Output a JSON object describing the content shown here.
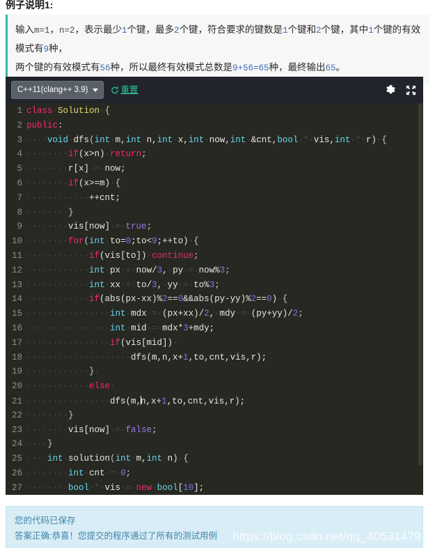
{
  "section": {
    "title": "例子说明1:",
    "explanation_line1_parts": [
      {
        "t": "输入",
        "k": "cn"
      },
      {
        "t": "m=1",
        "k": "mono"
      },
      {
        "t": "，",
        "k": "cn"
      },
      {
        "t": "n=2",
        "k": "mono"
      },
      {
        "t": "，表示最少",
        "k": "cn"
      },
      {
        "t": "1",
        "k": "num"
      },
      {
        "t": "个键，最多",
        "k": "cn"
      },
      {
        "t": "2",
        "k": "num"
      },
      {
        "t": "个键，符合要求的键数是",
        "k": "cn"
      },
      {
        "t": "1",
        "k": "num"
      },
      {
        "t": "个键和",
        "k": "cn"
      },
      {
        "t": "2",
        "k": "num"
      },
      {
        "t": "个键，其中",
        "k": "cn"
      },
      {
        "t": "1",
        "k": "num"
      },
      {
        "t": "个键的有效模式有",
        "k": "cn"
      },
      {
        "t": "9",
        "k": "num"
      },
      {
        "t": "种，",
        "k": "cn"
      }
    ],
    "explanation_line2_parts": [
      {
        "t": "两个键的有效模式有",
        "k": "cn"
      },
      {
        "t": "56",
        "k": "num"
      },
      {
        "t": "种，所以最终有效模式总数是",
        "k": "cn"
      },
      {
        "t": "9+56=65",
        "k": "num"
      },
      {
        "t": "种，最终输出",
        "k": "cn"
      },
      {
        "t": "65",
        "k": "num"
      },
      {
        "t": "。",
        "k": "cn"
      }
    ]
  },
  "editor": {
    "language_label": "C++11(clang++ 3.9)",
    "reset_label": "重置",
    "settings_icon": "gear-icon",
    "fullscreen_icon": "expand-icon",
    "dropdown_icon": "chevron-down-icon",
    "refresh_icon": "refresh-icon",
    "lines": [
      {
        "n": "1",
        "tokens": [
          {
            "t": "class",
            "k": "kw"
          },
          {
            "t": "·",
            "k": "ws"
          },
          {
            "t": "Solution",
            "k": "fn"
          },
          {
            "t": "·",
            "k": "ws"
          },
          {
            "t": "{",
            "k": "pun"
          }
        ]
      },
      {
        "n": "2",
        "tokens": [
          {
            "t": "public",
            "k": "kw"
          },
          {
            "t": ":",
            "k": "pun"
          }
        ]
      },
      {
        "n": "3",
        "tokens": [
          {
            "t": "····",
            "k": "ws"
          },
          {
            "t": "void",
            "k": "typ"
          },
          {
            "t": "·",
            "k": "ws"
          },
          {
            "t": "dfs",
            "k": "txt"
          },
          {
            "t": "(",
            "k": "pun"
          },
          {
            "t": "int",
            "k": "typ"
          },
          {
            "t": "·",
            "k": "ws"
          },
          {
            "t": "m,",
            "k": "txt"
          },
          {
            "t": "int",
            "k": "typ"
          },
          {
            "t": "·",
            "k": "ws"
          },
          {
            "t": "n,",
            "k": "txt"
          },
          {
            "t": "int",
            "k": "typ"
          },
          {
            "t": "·",
            "k": "ws"
          },
          {
            "t": "x,",
            "k": "txt"
          },
          {
            "t": "int",
            "k": "typ"
          },
          {
            "t": "·",
            "k": "ws"
          },
          {
            "t": "now,",
            "k": "txt"
          },
          {
            "t": "int",
            "k": "typ"
          },
          {
            "t": "·",
            "k": "ws"
          },
          {
            "t": "&cnt,",
            "k": "txt"
          },
          {
            "t": "bool",
            "k": "typ"
          },
          {
            "t": "·*·",
            "k": "ws"
          },
          {
            "t": "vis,",
            "k": "txt"
          },
          {
            "t": "int",
            "k": "typ"
          },
          {
            "t": "·*·",
            "k": "ws"
          },
          {
            "t": "r)",
            "k": "txt"
          },
          {
            "t": "·",
            "k": "ws"
          },
          {
            "t": "{",
            "k": "pun"
          }
        ]
      },
      {
        "n": "4",
        "tokens": [
          {
            "t": "········",
            "k": "ws"
          },
          {
            "t": "if",
            "k": "kw"
          },
          {
            "t": "(x>n)",
            "k": "txt"
          },
          {
            "t": "·",
            "k": "ws"
          },
          {
            "t": "return",
            "k": "kw"
          },
          {
            "t": ";",
            "k": "pun"
          }
        ]
      },
      {
        "n": "5",
        "tokens": [
          {
            "t": "········",
            "k": "ws"
          },
          {
            "t": "r[x]",
            "k": "txt"
          },
          {
            "t": "·=·",
            "k": "ws"
          },
          {
            "t": "now;",
            "k": "txt"
          }
        ]
      },
      {
        "n": "6",
        "tokens": [
          {
            "t": "········",
            "k": "ws"
          },
          {
            "t": "if",
            "k": "kw"
          },
          {
            "t": "(x>=m)",
            "k": "txt"
          },
          {
            "t": "·",
            "k": "ws"
          },
          {
            "t": "{",
            "k": "pun"
          }
        ]
      },
      {
        "n": "7",
        "tokens": [
          {
            "t": "············",
            "k": "ws"
          },
          {
            "t": "++cnt;",
            "k": "txt"
          }
        ]
      },
      {
        "n": "8",
        "tokens": [
          {
            "t": "········",
            "k": "ws"
          },
          {
            "t": "}",
            "k": "pun"
          }
        ]
      },
      {
        "n": "9",
        "tokens": [
          {
            "t": "········",
            "k": "ws"
          },
          {
            "t": "vis[now]",
            "k": "txt"
          },
          {
            "t": "·=·",
            "k": "ws"
          },
          {
            "t": "true",
            "k": "lit"
          },
          {
            "t": ";",
            "k": "pun"
          }
        ]
      },
      {
        "n": "10",
        "tokens": [
          {
            "t": "········",
            "k": "ws"
          },
          {
            "t": "for",
            "k": "kw"
          },
          {
            "t": "(",
            "k": "pun"
          },
          {
            "t": "int",
            "k": "typ"
          },
          {
            "t": "·",
            "k": "ws"
          },
          {
            "t": "to=",
            "k": "txt"
          },
          {
            "t": "0",
            "k": "num"
          },
          {
            "t": ";to<",
            "k": "txt"
          },
          {
            "t": "9",
            "k": "num"
          },
          {
            "t": ";++to)",
            "k": "txt"
          },
          {
            "t": "·",
            "k": "ws"
          },
          {
            "t": "{",
            "k": "pun"
          }
        ]
      },
      {
        "n": "11",
        "tokens": [
          {
            "t": "············",
            "k": "ws"
          },
          {
            "t": "if",
            "k": "kw"
          },
          {
            "t": "(vis[to])",
            "k": "txt"
          },
          {
            "t": "·",
            "k": "ws"
          },
          {
            "t": "continue",
            "k": "kw"
          },
          {
            "t": ";",
            "k": "pun"
          }
        ]
      },
      {
        "n": "12",
        "tokens": [
          {
            "t": "············",
            "k": "ws"
          },
          {
            "t": "int",
            "k": "typ"
          },
          {
            "t": "·",
            "k": "ws"
          },
          {
            "t": "px",
            "k": "txt"
          },
          {
            "t": "·=·",
            "k": "ws"
          },
          {
            "t": "now/",
            "k": "txt"
          },
          {
            "t": "3",
            "k": "num"
          },
          {
            "t": ",",
            "k": "txt"
          },
          {
            "t": "·",
            "k": "ws"
          },
          {
            "t": "py",
            "k": "txt"
          },
          {
            "t": "·=·",
            "k": "ws"
          },
          {
            "t": "now%",
            "k": "txt"
          },
          {
            "t": "3",
            "k": "num"
          },
          {
            "t": ";",
            "k": "pun"
          }
        ]
      },
      {
        "n": "13",
        "tokens": [
          {
            "t": "············",
            "k": "ws"
          },
          {
            "t": "int",
            "k": "typ"
          },
          {
            "t": "·",
            "k": "ws"
          },
          {
            "t": "xx",
            "k": "txt"
          },
          {
            "t": "·=·",
            "k": "ws"
          },
          {
            "t": "to/",
            "k": "txt"
          },
          {
            "t": "3",
            "k": "num"
          },
          {
            "t": ",",
            "k": "txt"
          },
          {
            "t": "·",
            "k": "ws"
          },
          {
            "t": "yy",
            "k": "txt"
          },
          {
            "t": "·=·",
            "k": "ws"
          },
          {
            "t": "to%",
            "k": "txt"
          },
          {
            "t": "3",
            "k": "num"
          },
          {
            "t": ";",
            "k": "pun"
          }
        ]
      },
      {
        "n": "14",
        "tokens": [
          {
            "t": "············",
            "k": "ws"
          },
          {
            "t": "if",
            "k": "kw"
          },
          {
            "t": "(abs(px-xx)%",
            "k": "txt"
          },
          {
            "t": "2",
            "k": "num"
          },
          {
            "t": "==",
            "k": "txt"
          },
          {
            "t": "0",
            "k": "num"
          },
          {
            "t": "&&abs(py-yy)%",
            "k": "txt"
          },
          {
            "t": "2",
            "k": "num"
          },
          {
            "t": "==",
            "k": "txt"
          },
          {
            "t": "0",
            "k": "num"
          },
          {
            "t": ")",
            "k": "txt"
          },
          {
            "t": "·",
            "k": "ws"
          },
          {
            "t": "{",
            "k": "pun"
          }
        ]
      },
      {
        "n": "15",
        "tokens": [
          {
            "t": "················",
            "k": "ws"
          },
          {
            "t": "int",
            "k": "typ"
          },
          {
            "t": "·",
            "k": "ws"
          },
          {
            "t": "mdx",
            "k": "txt"
          },
          {
            "t": "·=·",
            "k": "ws"
          },
          {
            "t": "(px+xx)/",
            "k": "txt"
          },
          {
            "t": "2",
            "k": "num"
          },
          {
            "t": ",",
            "k": "txt"
          },
          {
            "t": "·",
            "k": "ws"
          },
          {
            "t": "mdy",
            "k": "txt"
          },
          {
            "t": "·=·",
            "k": "ws"
          },
          {
            "t": "(py+yy)/",
            "k": "txt"
          },
          {
            "t": "2",
            "k": "num"
          },
          {
            "t": ";",
            "k": "pun"
          }
        ]
      },
      {
        "n": "16",
        "tokens": [
          {
            "t": "················",
            "k": "ws"
          },
          {
            "t": "int",
            "k": "typ"
          },
          {
            "t": "·",
            "k": "ws"
          },
          {
            "t": "mid",
            "k": "txt"
          },
          {
            "t": "·=·",
            "k": "ws"
          },
          {
            "t": "mdx*",
            "k": "txt"
          },
          {
            "t": "3",
            "k": "num"
          },
          {
            "t": "+mdy;",
            "k": "txt"
          }
        ]
      },
      {
        "n": "17",
        "tokens": [
          {
            "t": "················",
            "k": "ws"
          },
          {
            "t": "if",
            "k": "kw"
          },
          {
            "t": "(vis[mid])",
            "k": "txt"
          },
          {
            "t": "·",
            "k": "ws"
          }
        ]
      },
      {
        "n": "18",
        "tokens": [
          {
            "t": "····················",
            "k": "ws"
          },
          {
            "t": "dfs(m,n,x+",
            "k": "txt"
          },
          {
            "t": "1",
            "k": "num"
          },
          {
            "t": ",to,cnt,vis,r);",
            "k": "txt"
          }
        ]
      },
      {
        "n": "19",
        "tokens": [
          {
            "t": "············",
            "k": "ws"
          },
          {
            "t": "}",
            "k": "pun"
          },
          {
            "t": "·",
            "k": "ws"
          }
        ]
      },
      {
        "n": "20",
        "tokens": [
          {
            "t": "············",
            "k": "ws"
          },
          {
            "t": "else",
            "k": "kw"
          },
          {
            "t": "·",
            "k": "ws"
          }
        ]
      },
      {
        "n": "21",
        "tokens": [
          {
            "t": "················",
            "k": "ws"
          },
          {
            "t": "dfs(m,",
            "k": "txt"
          },
          {
            "t": "|CARET|",
            "k": "caret"
          },
          {
            "t": "n,x+",
            "k": "txt"
          },
          {
            "t": "1",
            "k": "num"
          },
          {
            "t": ",to,cnt,vis,r);",
            "k": "txt"
          }
        ]
      },
      {
        "n": "22",
        "tokens": [
          {
            "t": "········",
            "k": "ws"
          },
          {
            "t": "}",
            "k": "pun"
          }
        ]
      },
      {
        "n": "23",
        "tokens": [
          {
            "t": "········",
            "k": "ws"
          },
          {
            "t": "vis[now]",
            "k": "txt"
          },
          {
            "t": "·=·",
            "k": "ws"
          },
          {
            "t": "false",
            "k": "lit"
          },
          {
            "t": ";",
            "k": "pun"
          }
        ]
      },
      {
        "n": "24",
        "tokens": [
          {
            "t": "····",
            "k": "ws"
          },
          {
            "t": "}",
            "k": "pun"
          }
        ]
      },
      {
        "n": "25",
        "tokens": [
          {
            "t": "····",
            "k": "ws"
          },
          {
            "t": "int",
            "k": "typ"
          },
          {
            "t": "·",
            "k": "ws"
          },
          {
            "t": "solution",
            "k": "txt"
          },
          {
            "t": "(",
            "k": "pun"
          },
          {
            "t": "int",
            "k": "typ"
          },
          {
            "t": "·",
            "k": "ws"
          },
          {
            "t": "m,",
            "k": "txt"
          },
          {
            "t": "int",
            "k": "typ"
          },
          {
            "t": "·",
            "k": "ws"
          },
          {
            "t": "n)",
            "k": "txt"
          },
          {
            "t": "·",
            "k": "ws"
          },
          {
            "t": "{",
            "k": "pun"
          }
        ]
      },
      {
        "n": "26",
        "tokens": [
          {
            "t": "········",
            "k": "ws"
          },
          {
            "t": "int",
            "k": "typ"
          },
          {
            "t": "·",
            "k": "ws"
          },
          {
            "t": "cnt",
            "k": "txt"
          },
          {
            "t": "·=·",
            "k": "ws"
          },
          {
            "t": "0",
            "k": "num"
          },
          {
            "t": ";",
            "k": "pun"
          }
        ]
      },
      {
        "n": "27",
        "tokens": [
          {
            "t": "········",
            "k": "ws"
          },
          {
            "t": "bool",
            "k": "typ"
          },
          {
            "t": "·*·",
            "k": "ws"
          },
          {
            "t": "vis",
            "k": "txt"
          },
          {
            "t": "·=·",
            "k": "ws"
          },
          {
            "t": "new",
            "k": "kw"
          },
          {
            "t": "·",
            "k": "ws"
          },
          {
            "t": "bool",
            "k": "typ"
          },
          {
            "t": "[",
            "k": "txt"
          },
          {
            "t": "10",
            "k": "num"
          },
          {
            "t": "];",
            "k": "txt"
          }
        ]
      }
    ]
  },
  "status": {
    "line1": "您的代码已保存",
    "line2": "答案正确:恭喜！您提交的程序通过了所有的测试用例",
    "watermark": "https://blog.csdn.net/qq_40531479"
  },
  "colors": {
    "editor_bg": "#272822",
    "toolbar_bg": "#21252b",
    "accent_green": "#2ec4a0",
    "status_bg": "#d9edf7",
    "status_border": "#bce8f1",
    "status_text": "#3f85a8",
    "keyword": "#f92672",
    "type": "#66d9ef",
    "literal": "#9a7ae6",
    "number": "#7a7ae6",
    "classname": "#e6db74"
  }
}
